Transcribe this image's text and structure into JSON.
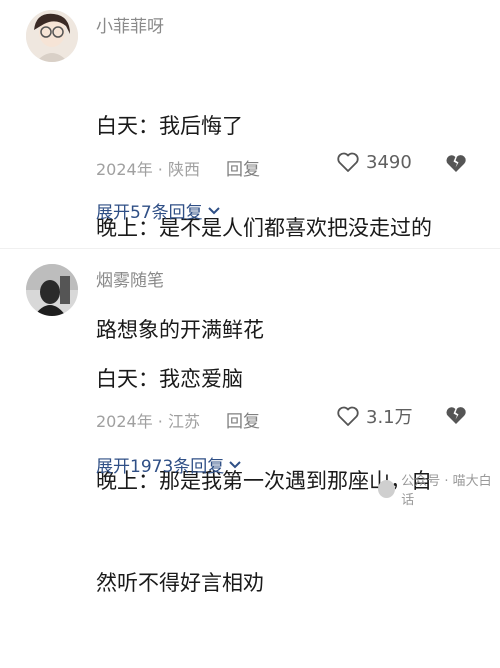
{
  "comments": [
    {
      "username": "小菲菲呀",
      "lines": [
        "白天：我后悔了",
        "晚上：是不是人们都喜欢把没走过的",
        "路想象的开满鲜花"
      ],
      "meta": "2024年 · 陕西",
      "reply_label": "回复",
      "likes": "3490",
      "expand_label": "展开57条回复"
    },
    {
      "username": "烟雾随笔",
      "lines": [
        "白天：我恋爱脑",
        "晚上：那是我第一次遇到那座山，自",
        "然听不得好言相劝"
      ],
      "meta": "2024年 · 江苏",
      "reply_label": "回复",
      "likes": "3.1万",
      "expand_label": "展开1973条回复"
    }
  ],
  "watermark": "公众号 · 喵大白话",
  "icons": {
    "like": "heart-outline-icon",
    "dislike": "broken-heart-icon",
    "expand": "chevron-down-icon"
  },
  "colors": {
    "link": "#2f4f86",
    "muted": "#a0a0a0",
    "text": "#1a1a1a"
  }
}
